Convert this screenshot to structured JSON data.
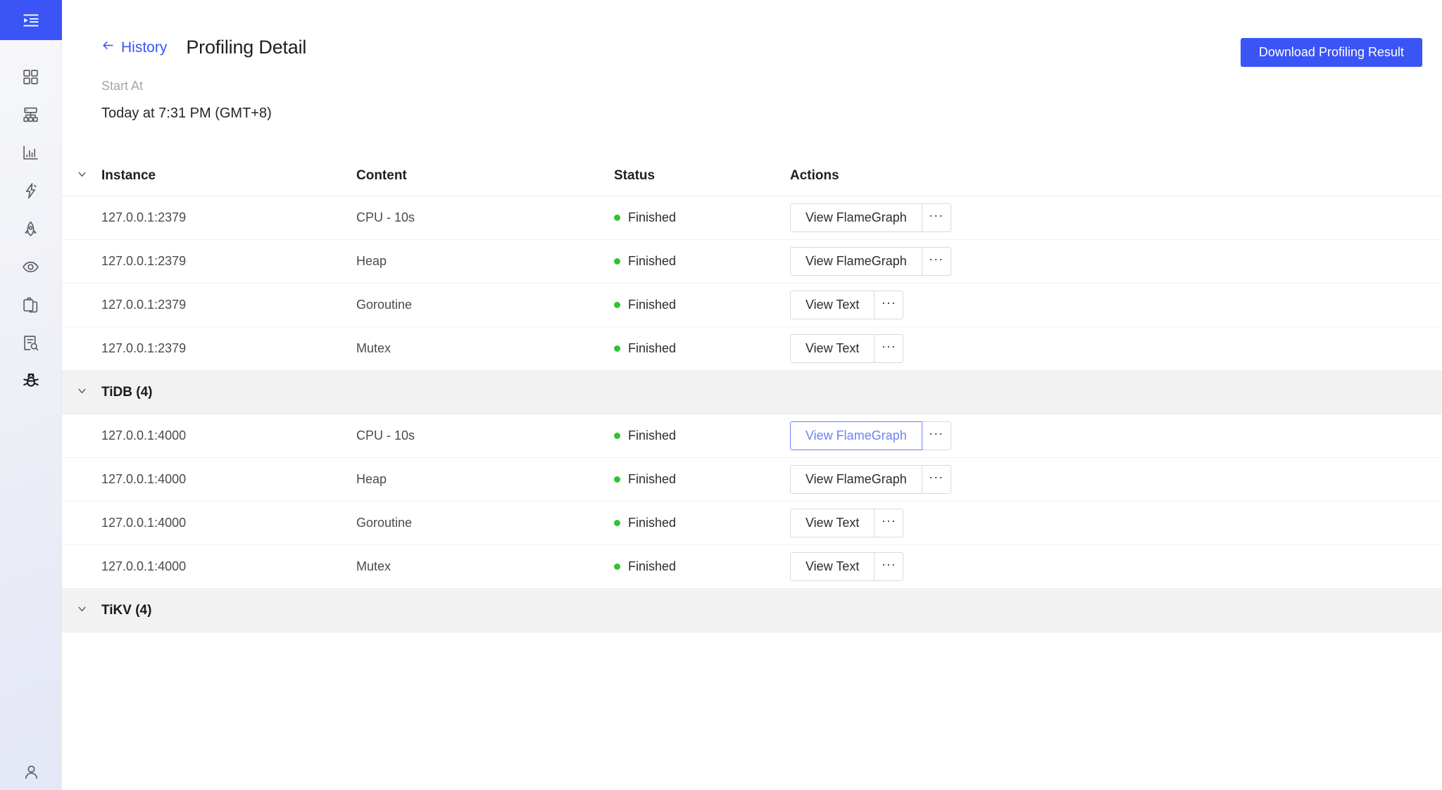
{
  "sidebar": {
    "top_icon": "collapse-menu-icon",
    "items": [
      {
        "icon": "dashboard-grid-icon",
        "name": "overview",
        "active": false
      },
      {
        "icon": "cluster-topology-icon",
        "name": "cluster-info",
        "active": false
      },
      {
        "icon": "bar-chart-icon",
        "name": "key-visualizer",
        "active": false
      },
      {
        "icon": "lightning-icon",
        "name": "statements",
        "active": false
      },
      {
        "icon": "rocket-icon",
        "name": "slow-queries",
        "active": false
      },
      {
        "icon": "eye-icon",
        "name": "diagnose",
        "active": false
      },
      {
        "icon": "clipboard-copy-icon",
        "name": "search-logs",
        "active": false
      },
      {
        "icon": "document-search-icon",
        "name": "instance-profiling",
        "active": false
      },
      {
        "icon": "bug-icon",
        "name": "advanced-debugging",
        "active": true
      }
    ],
    "footer_icon": "user-account-icon"
  },
  "header": {
    "back_label": "History",
    "back_icon": "arrow-left-icon",
    "title": "Profiling Detail",
    "download_label": "Download Profiling Result"
  },
  "meta": {
    "start_at_label": "Start At",
    "start_at_value": "Today at 7:31 PM (GMT+8)"
  },
  "table": {
    "columns": {
      "instance": "Instance",
      "content": "Content",
      "status": "Status",
      "actions": "Actions"
    },
    "caret_icon": "chevron-down-icon",
    "more_label": "···",
    "rows": [
      {
        "type": "data",
        "instance": "127.0.0.1:2379",
        "content": "CPU - 10s",
        "status": "Finished",
        "action": "View FlameGraph",
        "focused": false
      },
      {
        "type": "data",
        "instance": "127.0.0.1:2379",
        "content": "Heap",
        "status": "Finished",
        "action": "View FlameGraph",
        "focused": false
      },
      {
        "type": "data",
        "instance": "127.0.0.1:2379",
        "content": "Goroutine",
        "status": "Finished",
        "action": "View Text",
        "focused": false
      },
      {
        "type": "data",
        "instance": "127.0.0.1:2379",
        "content": "Mutex",
        "status": "Finished",
        "action": "View Text",
        "focused": false
      },
      {
        "type": "group",
        "label": "TiDB (4)"
      },
      {
        "type": "data",
        "instance": "127.0.0.1:4000",
        "content": "CPU - 10s",
        "status": "Finished",
        "action": "View FlameGraph",
        "focused": true
      },
      {
        "type": "data",
        "instance": "127.0.0.1:4000",
        "content": "Heap",
        "status": "Finished",
        "action": "View FlameGraph",
        "focused": false
      },
      {
        "type": "data",
        "instance": "127.0.0.1:4000",
        "content": "Goroutine",
        "status": "Finished",
        "action": "View Text",
        "focused": false
      },
      {
        "type": "data",
        "instance": "127.0.0.1:4000",
        "content": "Mutex",
        "status": "Finished",
        "action": "View Text",
        "focused": false
      },
      {
        "type": "group",
        "label": "TiKV (4)"
      }
    ]
  },
  "colors": {
    "accent": "#3a54f5",
    "status_ok": "#2fc42f",
    "group_bg": "#f2f2f2",
    "focus_border": "#6d82f7"
  }
}
